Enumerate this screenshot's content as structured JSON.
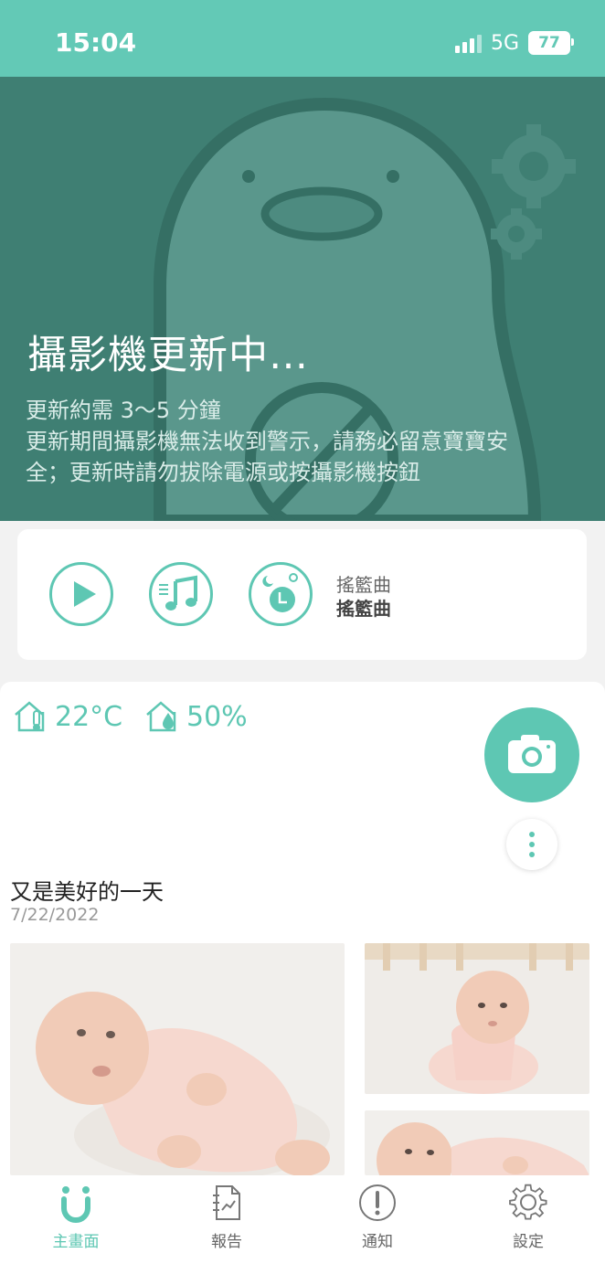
{
  "status_bar": {
    "time": "15:04",
    "network": "5G",
    "battery": "77"
  },
  "banner": {
    "title": "攝影機更新中…",
    "line1": "更新約需 3〜5 分鐘",
    "line2": "更新期間攝影機無法收到警示，請務必留意寶寶安",
    "line3": "全；更新時請勿拔除電源或按攝影機按鈕"
  },
  "lullaby": {
    "track_label": "搖籃曲",
    "track_name": "搖籃曲"
  },
  "environment": {
    "temperature": "22°C",
    "humidity": "50%"
  },
  "feed": {
    "title": "又是美好的一天",
    "date": "7/22/2022"
  },
  "nav": [
    {
      "label": "主畫面",
      "active": true
    },
    {
      "label": "報告"
    },
    {
      "label": "通知"
    },
    {
      "label": "設定"
    }
  ],
  "colors": {
    "accent": "#5ec7b3",
    "status_bar": "#63c9b6",
    "banner_bg": "#3f7f73"
  }
}
